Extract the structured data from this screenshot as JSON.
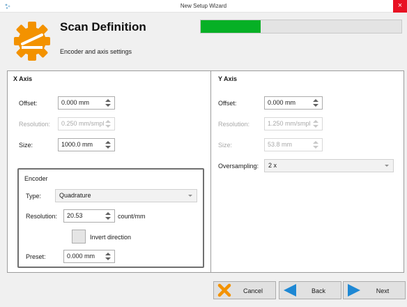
{
  "window": {
    "title": "New Setup Wizard",
    "close_label": "×"
  },
  "header": {
    "title": "Scan Definition",
    "subtitle": "Encoder and axis settings",
    "progress_fraction": 0.3
  },
  "x_axis": {
    "title": "X Axis",
    "offset": {
      "label": "Offset:",
      "value": "0.000 mm"
    },
    "resolution": {
      "label": "Resolution:",
      "value": "0.250 mm/smpl"
    },
    "size": {
      "label": "Size:",
      "value": "1000.0 mm"
    }
  },
  "encoder": {
    "title": "Encoder",
    "type": {
      "label": "Type:",
      "value": "Quadrature"
    },
    "resolution": {
      "label": "Resolution:",
      "value": "20.53",
      "unit": "count/mm"
    },
    "invert": {
      "label": "Invert direction",
      "checked": false
    },
    "preset": {
      "label": "Preset:",
      "value": "0.000 mm"
    }
  },
  "y_axis": {
    "title": "Y Axis",
    "offset": {
      "label": "Offset:",
      "value": "0.000 mm"
    },
    "resolution": {
      "label": "Resolution:",
      "value": "1.250 mm/smpl"
    },
    "size": {
      "label": "Size:",
      "value": "53.8 mm"
    },
    "oversampling": {
      "label": "Oversampling:",
      "value": "2 x"
    }
  },
  "buttons": {
    "cancel": "Cancel",
    "back": "Back",
    "next": "Next"
  },
  "colors": {
    "progress": "#06b025",
    "logo": "#f39200",
    "nav_arrow": "#1e88d4",
    "cancel_x": "#f39200",
    "close": "#e81123"
  },
  "icons": {
    "logo": "wrench-gear-icon",
    "cancel": "x-icon",
    "back": "arrow-left-icon",
    "next": "arrow-right-icon"
  }
}
